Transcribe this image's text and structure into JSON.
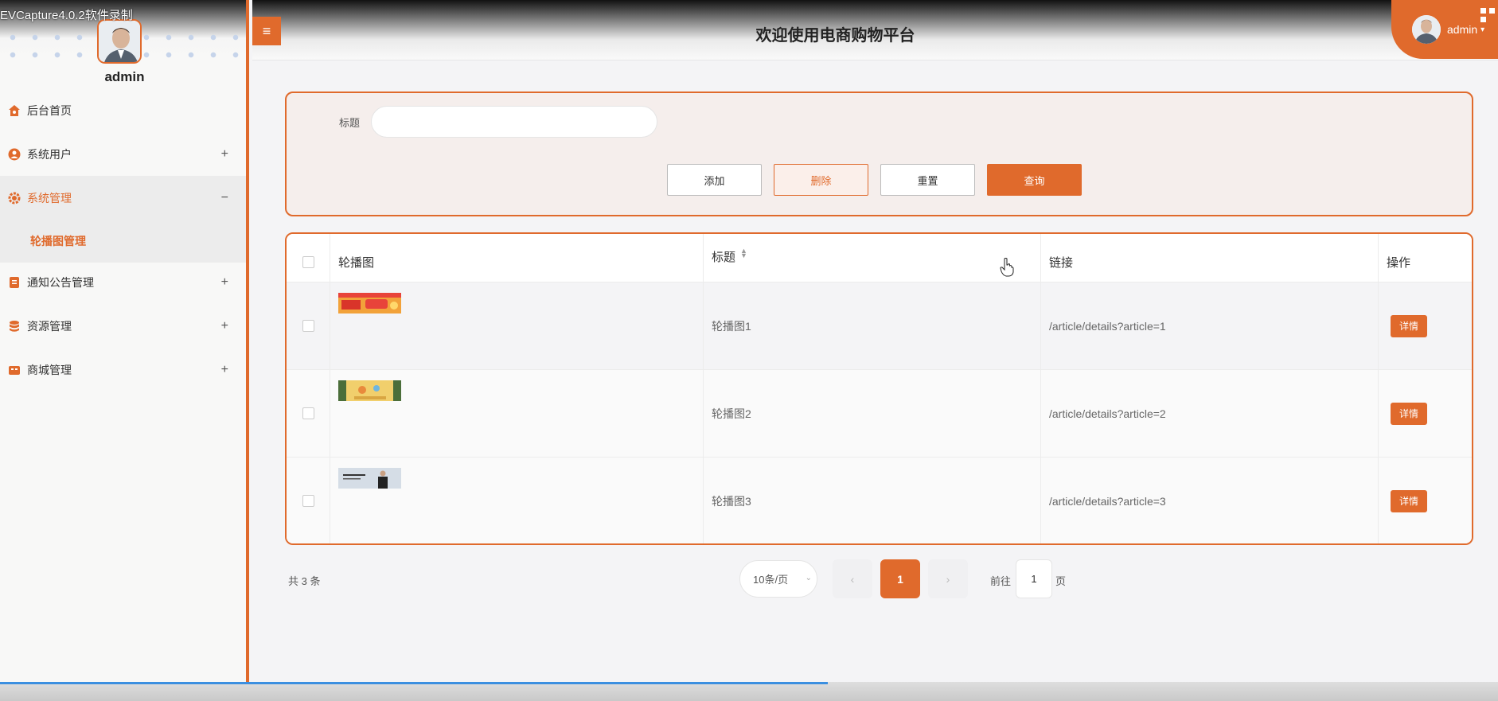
{
  "watermark": "EVCapture4.0.2软件录制",
  "header": {
    "title": "欢迎使用电商购物平台",
    "username": "admin"
  },
  "sidebar": {
    "admin_name": "admin",
    "items": [
      {
        "label": "后台首页",
        "icon": "home-icon",
        "toggle": ""
      },
      {
        "label": "系统用户",
        "icon": "user-icon",
        "toggle": "+"
      },
      {
        "label": "系统管理",
        "icon": "gear-icon",
        "toggle": "−"
      },
      {
        "label": "通知公告管理",
        "icon": "document-icon",
        "toggle": "+"
      },
      {
        "label": "资源管理",
        "icon": "database-icon",
        "toggle": "+"
      },
      {
        "label": "商城管理",
        "icon": "shop-icon",
        "toggle": "+"
      }
    ],
    "submenu": {
      "label": "轮播图管理"
    }
  },
  "search": {
    "title_label": "标题",
    "title_value": "",
    "buttons": {
      "add": "添加",
      "delete": "删除",
      "reset": "重置",
      "query": "查询"
    }
  },
  "table": {
    "columns": [
      "轮播图",
      "标题",
      "链接",
      "操作"
    ],
    "rows": [
      {
        "title": "轮播图1",
        "link": "/article/details?article=1",
        "action": "详情"
      },
      {
        "title": "轮播图2",
        "link": "/article/details?article=2",
        "action": "详情"
      },
      {
        "title": "轮播图3",
        "link": "/article/details?article=3",
        "action": "详情"
      }
    ]
  },
  "pagination": {
    "total": "共 3 条",
    "page_size": "10条/页",
    "current": "1",
    "goto_prefix": "前往",
    "goto_value": "1",
    "goto_suffix": "页"
  },
  "colors": {
    "accent": "#e06a2c"
  }
}
